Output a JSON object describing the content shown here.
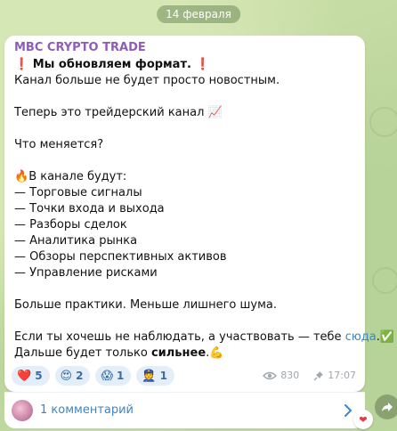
{
  "date_label": "14 февраля",
  "post": {
    "channel_name": "MBC CRYPTO TRADE",
    "title_mark_left": "❗",
    "title": "Мы обновляем формат.",
    "title_mark_right": "❗",
    "line1": "Канал больше не будет просто новостным.",
    "line2": "Теперь это трейдерский канал 📈",
    "line3": "Что меняется?",
    "list_header_icon": "🔥",
    "list_header": "В канале будут:",
    "list_items": [
      "— Торговые сигналы",
      "— Точки входа и выхода",
      "— Разборы сделок",
      "— Аналитика рынка",
      "— Обзоры перспективных активов",
      "— Управление рисками"
    ],
    "line4": "Больше практики. Меньше лишнего шума.",
    "line5_pre": "Если ты хочешь не наблюдать, а участвовать — тебе ",
    "line5_link": "сюда",
    "line5_post": ".✅",
    "line6_pre": "Дальше будет только ",
    "line6_bold": "сильнее",
    "line6_post": ".💪"
  },
  "reactions": [
    {
      "emoji": "❤️",
      "count": "5"
    },
    {
      "emoji": "😍",
      "count": "2"
    },
    {
      "emoji": "😱",
      "count": "1"
    },
    {
      "emoji": "👮",
      "count": "1"
    }
  ],
  "views": "830",
  "time": "17:07",
  "comments_label": "1 комментарий",
  "colors": {
    "channel_name": "#8e5db8",
    "link": "#3a86c8",
    "reaction_bg": "#e4eef8",
    "reaction_text": "#3a6ea5",
    "meta": "#a0a7ad"
  },
  "icons": [
    "eye-icon",
    "pin-icon",
    "chevron-right-icon",
    "share-arrow-icon",
    "heart-icon"
  ]
}
